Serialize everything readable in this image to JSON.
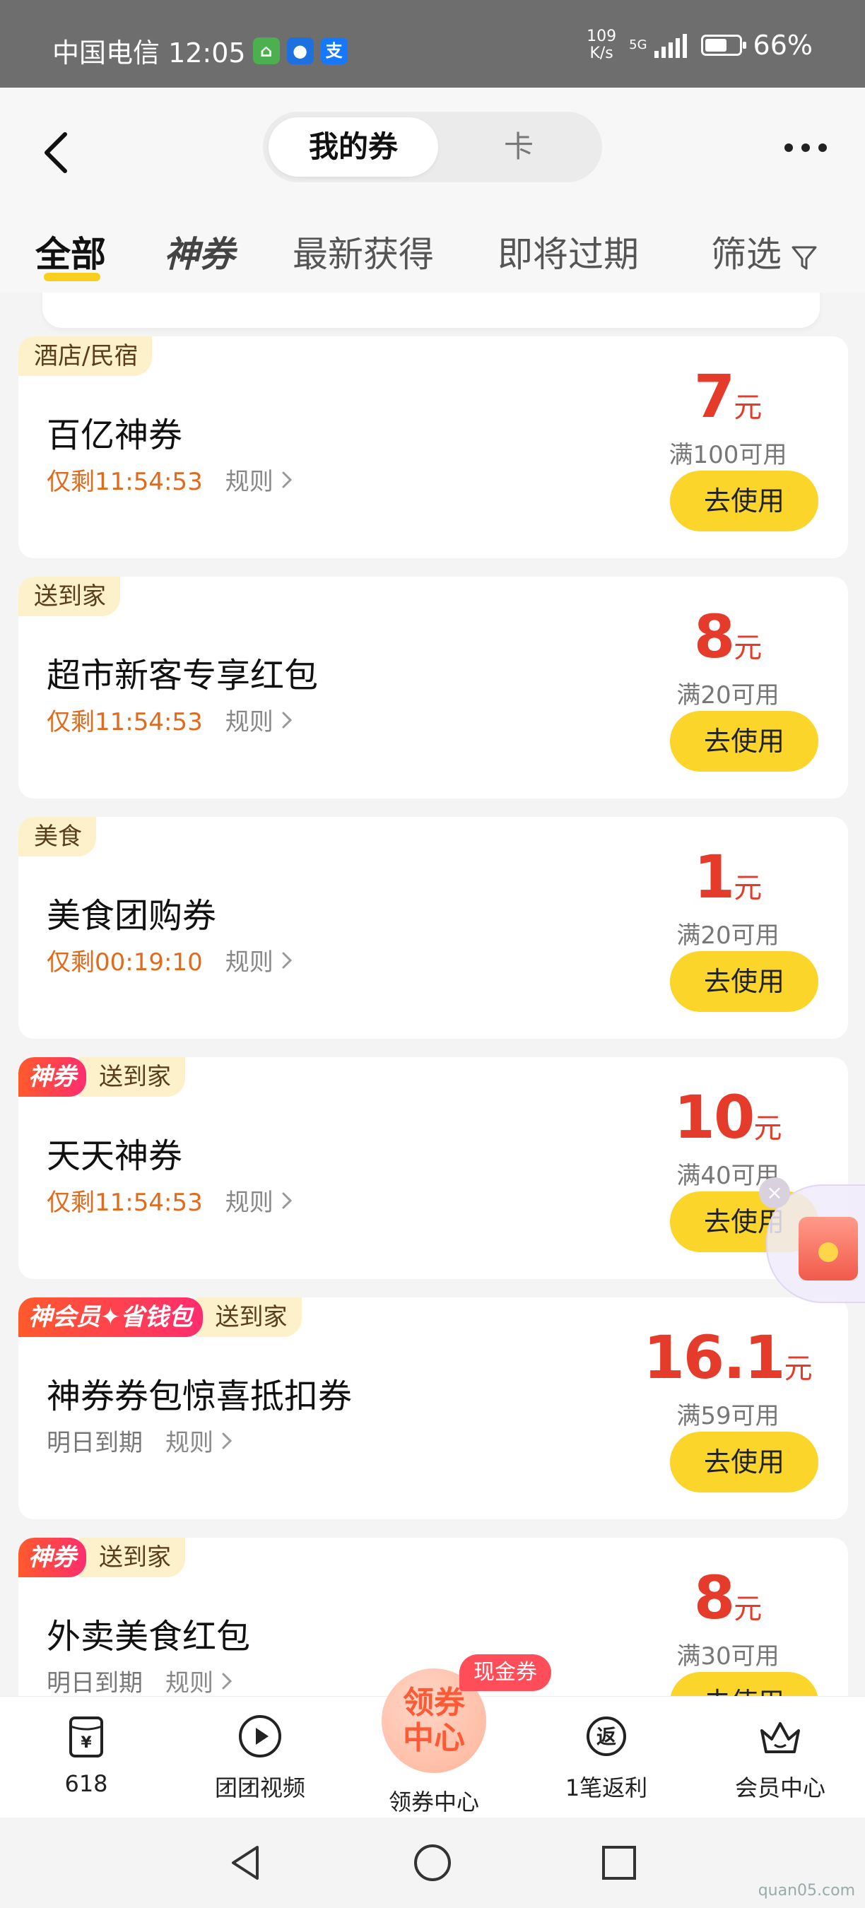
{
  "status_bar": {
    "carrier_time": "中国电信 12:05",
    "app_icons": [
      {
        "name": "home-app-icon",
        "color": "#4caf50"
      },
      {
        "name": "penguin-app-icon",
        "color": "#1e6fe0"
      },
      {
        "name": "alipay-app-icon",
        "color": "#1677ff"
      }
    ],
    "alipay_glyph": "支",
    "net_speed_value": "109",
    "net_speed_unit": "K/s",
    "network": "5G",
    "battery": "66%",
    "battery_level": 0.66
  },
  "header": {
    "segments": [
      "我的券",
      "卡"
    ],
    "active_segment": "我的券"
  },
  "filter_tabs": [
    "全部",
    "神券",
    "最新获得",
    "即将过期",
    "筛选"
  ],
  "active_filter": "全部",
  "coupons": [
    {
      "tags": [
        "酒店/民宿"
      ],
      "shen": null,
      "title": "百亿神券",
      "expiry": "仅剩11:54:53",
      "expiry_style": "red",
      "rules": "规则",
      "amount": "7",
      "unit": "元",
      "condition": "满100可用",
      "button": "去使用"
    },
    {
      "tags": [
        "送到家"
      ],
      "shen": null,
      "title": "超市新客专享红包",
      "expiry": "仅剩11:54:53",
      "expiry_style": "red",
      "rules": "规则",
      "amount": "8",
      "unit": "元",
      "condition": "满20可用",
      "button": "去使用"
    },
    {
      "tags": [
        "美食"
      ],
      "shen": null,
      "title": "美食团购券",
      "expiry": "仅剩00:19:10",
      "expiry_style": "red",
      "rules": "规则",
      "amount": "1",
      "unit": "元",
      "condition": "满20可用",
      "button": "去使用"
    },
    {
      "tags": [
        "送到家"
      ],
      "shen": "神券",
      "title": "天天神券",
      "expiry": "仅剩11:54:53",
      "expiry_style": "red",
      "rules": "规则",
      "amount": "10",
      "unit": "元",
      "condition": "满40可用",
      "button": "去使用"
    },
    {
      "tags": [
        "送到家"
      ],
      "shen": "神会员✦省钱包",
      "title": "神券券包惊喜抵扣券",
      "expiry": "明日到期",
      "expiry_style": "gray",
      "rules": "规则",
      "amount": "16.1",
      "unit": "元",
      "condition": "满59可用",
      "button": "去使用"
    },
    {
      "tags": [
        "送到家"
      ],
      "shen": "神券",
      "title": "外卖美食红包",
      "expiry": "明日到期",
      "expiry_style": "gray",
      "rules": "规则",
      "amount": "8",
      "unit": "元",
      "condition": "满30可用",
      "button": "去使用"
    }
  ],
  "bottom_nav": {
    "items": [
      {
        "label": "618",
        "icon": "coupon-yen-icon"
      },
      {
        "label": "团团视频",
        "icon": "play-icon"
      },
      {
        "label": "领券中心",
        "icon": "coupon-center-icon"
      },
      {
        "label": "1笔返利",
        "icon": "rebate-icon"
      },
      {
        "label": "会员中心",
        "icon": "crown-icon"
      }
    ],
    "center_text": [
      "领券",
      "中心"
    ],
    "badge": "现金券",
    "yen_glyph": "¥",
    "rebate_glyph": "返"
  },
  "watermark": "quan05.com",
  "colors": {
    "accent_yellow": "#fcd52b",
    "price_red": "#e53b2a",
    "expiry_orange": "#e06a1e"
  }
}
